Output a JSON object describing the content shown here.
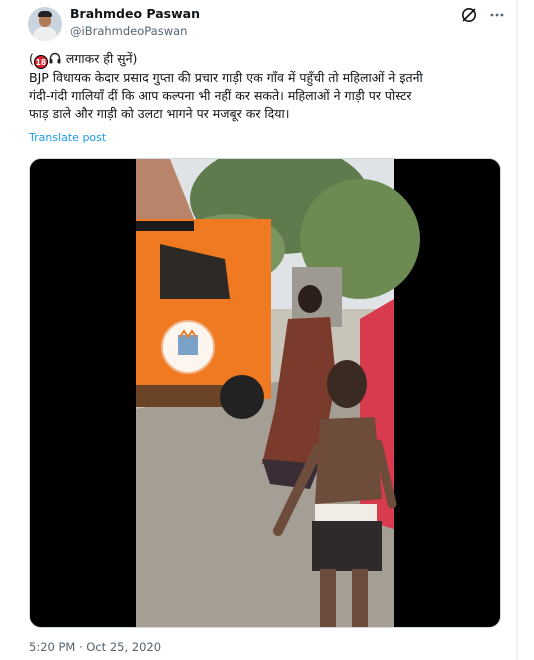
{
  "tweet": {
    "author_name": "Brahmdeo Paswan",
    "author_handle": "@iBrahmdeoPaswan",
    "text_prefix": "(",
    "age_badge": "18",
    "text_line1_rest": " लगाकर ही सुनें)",
    "text_line2": "BJP विधायक केदार प्रसाद गुप्ता की प्रचार गाड़ी एक गाँव में पहुँची तो महिलाओं ने इतनी",
    "text_line3": "गंदी-गंदी गालियाँ दीं कि आप कल्पना भी नहीं कर सकते। महिलाओं ने गाड़ी पर पोस्टर",
    "text_line4": "फाड़ डाले और गाड़ी को उलटा भागने पर मजबूर कर दिया।",
    "translate_label": "Translate post",
    "timestamp": "5:20 PM · Oct 25, 2020"
  },
  "icons": {
    "grok": "grok-icon",
    "more": "more-options-icon",
    "headphone": "headphone-icon",
    "adult_badge": "18-plus-icon"
  },
  "colors": {
    "link": "#1d9bf0",
    "secondary_text": "#536471",
    "vehicle_orange": "#f07a22"
  }
}
